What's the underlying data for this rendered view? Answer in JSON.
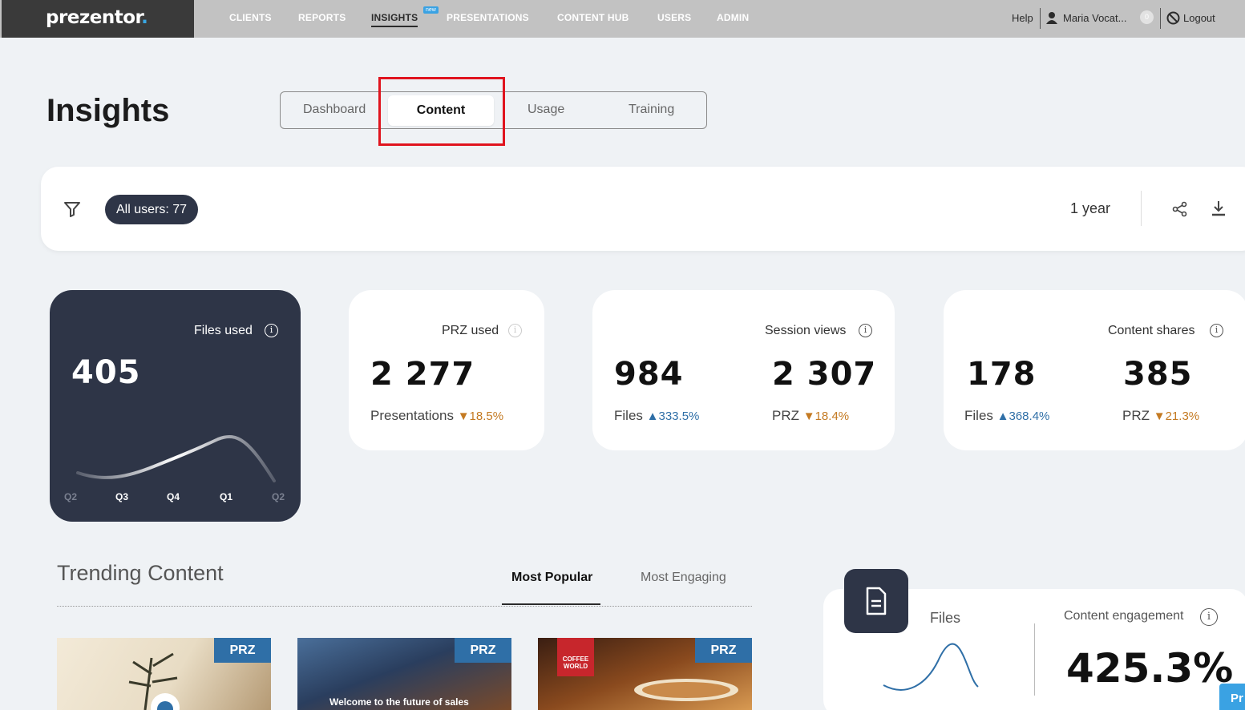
{
  "app": {
    "logo_text": "prezentor",
    "logo_dot": "."
  },
  "nav": {
    "items": [
      "CLIENTS",
      "REPORTS",
      "INSIGHTS",
      "PRESENTATIONS",
      "CONTENT HUB",
      "USERS",
      "ADMIN"
    ],
    "active": "INSIGHTS",
    "new_badge": "new"
  },
  "top_right": {
    "help": "Help",
    "user": "Maria Vocat...",
    "notifications": "0",
    "logout": "Logout"
  },
  "page": {
    "title": "Insights",
    "tabs": [
      "Dashboard",
      "Content",
      "Usage",
      "Training"
    ],
    "active_tab": "Content"
  },
  "filter": {
    "users_pill": "All users: 77",
    "period": "1 year"
  },
  "stats": {
    "files_used": {
      "label": "Files used",
      "value": "405",
      "quarters": [
        "Q2",
        "Q3",
        "Q4",
        "Q1",
        "Q2"
      ]
    },
    "przr_used": {
      "label": "PRZ used",
      "value": "2 277",
      "sub_label": "Presentations",
      "change": "18.5%",
      "direction": "down"
    },
    "session_views": {
      "label": "Session views",
      "files_value": "984",
      "files_label": "Files",
      "files_change": "333.5%",
      "files_dir": "up",
      "prz_value": "2 307",
      "prz_label": "PRZ",
      "prz_change": "18.4%",
      "prz_dir": "down"
    },
    "content_shares": {
      "label": "Content shares",
      "files_value": "178",
      "files_label": "Files",
      "files_change": "368.4%",
      "files_dir": "up",
      "prz_value": "385",
      "prz_label": "PRZ",
      "prz_change": "21.3%",
      "prz_dir": "down"
    }
  },
  "trending": {
    "title": "Trending Content",
    "tabs": [
      "Most Popular",
      "Most Engaging"
    ],
    "active_tab": "Most Popular",
    "items": [
      {
        "tag": "PRZ",
        "caption": ""
      },
      {
        "tag": "PRZ",
        "caption": "Welcome to the future of sales"
      },
      {
        "tag": "PRZ",
        "caption": "",
        "logo": "COFFEE WORLD"
      }
    ]
  },
  "engagement": {
    "files_label": "Files",
    "label": "Content engagement",
    "value": "425.3%"
  },
  "corner_button": "Pr",
  "colors": {
    "dark_card": "#2e3547",
    "accent_blue": "#2f6fa7",
    "accent_orange": "#c47a22",
    "highlight_red": "#e0141e"
  },
  "icons": [
    "filter-icon",
    "share-icon",
    "download-icon",
    "info-icon",
    "user-icon",
    "logout-icon",
    "document-icon"
  ]
}
